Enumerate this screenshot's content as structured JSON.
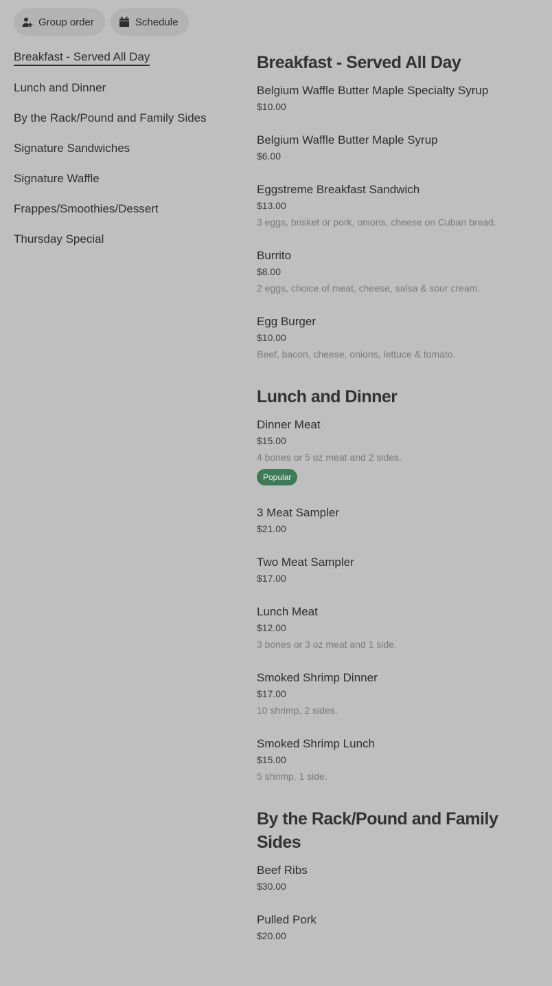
{
  "actions": {
    "group_order": "Group order",
    "schedule": "Schedule"
  },
  "nav": {
    "items": [
      {
        "label": "Breakfast - Served All Day",
        "active": true
      },
      {
        "label": "Lunch and Dinner"
      },
      {
        "label": "By the Rack/Pound and Family Sides"
      },
      {
        "label": "Signature Sandwiches"
      },
      {
        "label": "Signature Waffle"
      },
      {
        "label": "Frappes/Smoothies/Dessert"
      },
      {
        "label": "Thursday Special"
      }
    ]
  },
  "menu": {
    "sections": [
      {
        "title": "Breakfast - Served All Day",
        "items": [
          {
            "name": "Belgium Waffle Butter Maple Specialty Syrup",
            "price": "$10.00"
          },
          {
            "name": "Belgium Waffle Butter Maple Syrup",
            "price": "$6.00"
          },
          {
            "name": "Eggstreme Breakfast Sandwich",
            "price": "$13.00",
            "desc": "3 eggs, brisket or pork, onions, cheese on Cuban bread."
          },
          {
            "name": "Burrito",
            "price": "$8.00",
            "desc": "2 eggs, choice of meat, cheese, salsa & sour cream."
          },
          {
            "name": "Egg Burger",
            "price": "$10.00",
            "desc": "Beef, bacon, cheese, onions, lettuce & tomato."
          }
        ]
      },
      {
        "title": "Lunch and Dinner",
        "items": [
          {
            "name": "Dinner Meat",
            "price": "$15.00",
            "desc": "4 bones or 5 oz meat and 2 sides.",
            "badge": "Popular"
          },
          {
            "name": "3 Meat Sampler",
            "price": "$21.00"
          },
          {
            "name": "Two Meat Sampler",
            "price": "$17.00"
          },
          {
            "name": "Lunch Meat",
            "price": "$12.00",
            "desc": "3 bones or 3 oz meat and 1 side."
          },
          {
            "name": "Smoked Shrimp Dinner",
            "price": "$17.00",
            "desc": "10 shrimp, 2 sides."
          },
          {
            "name": "Smoked Shrimp Lunch",
            "price": "$15.00",
            "desc": "5 shrimp, 1 side."
          }
        ]
      },
      {
        "title": "By the Rack/Pound and Family Sides",
        "items": [
          {
            "name": "Beef Ribs",
            "price": "$30.00"
          },
          {
            "name": "Pulled Pork",
            "price": "$20.00"
          }
        ]
      }
    ]
  }
}
